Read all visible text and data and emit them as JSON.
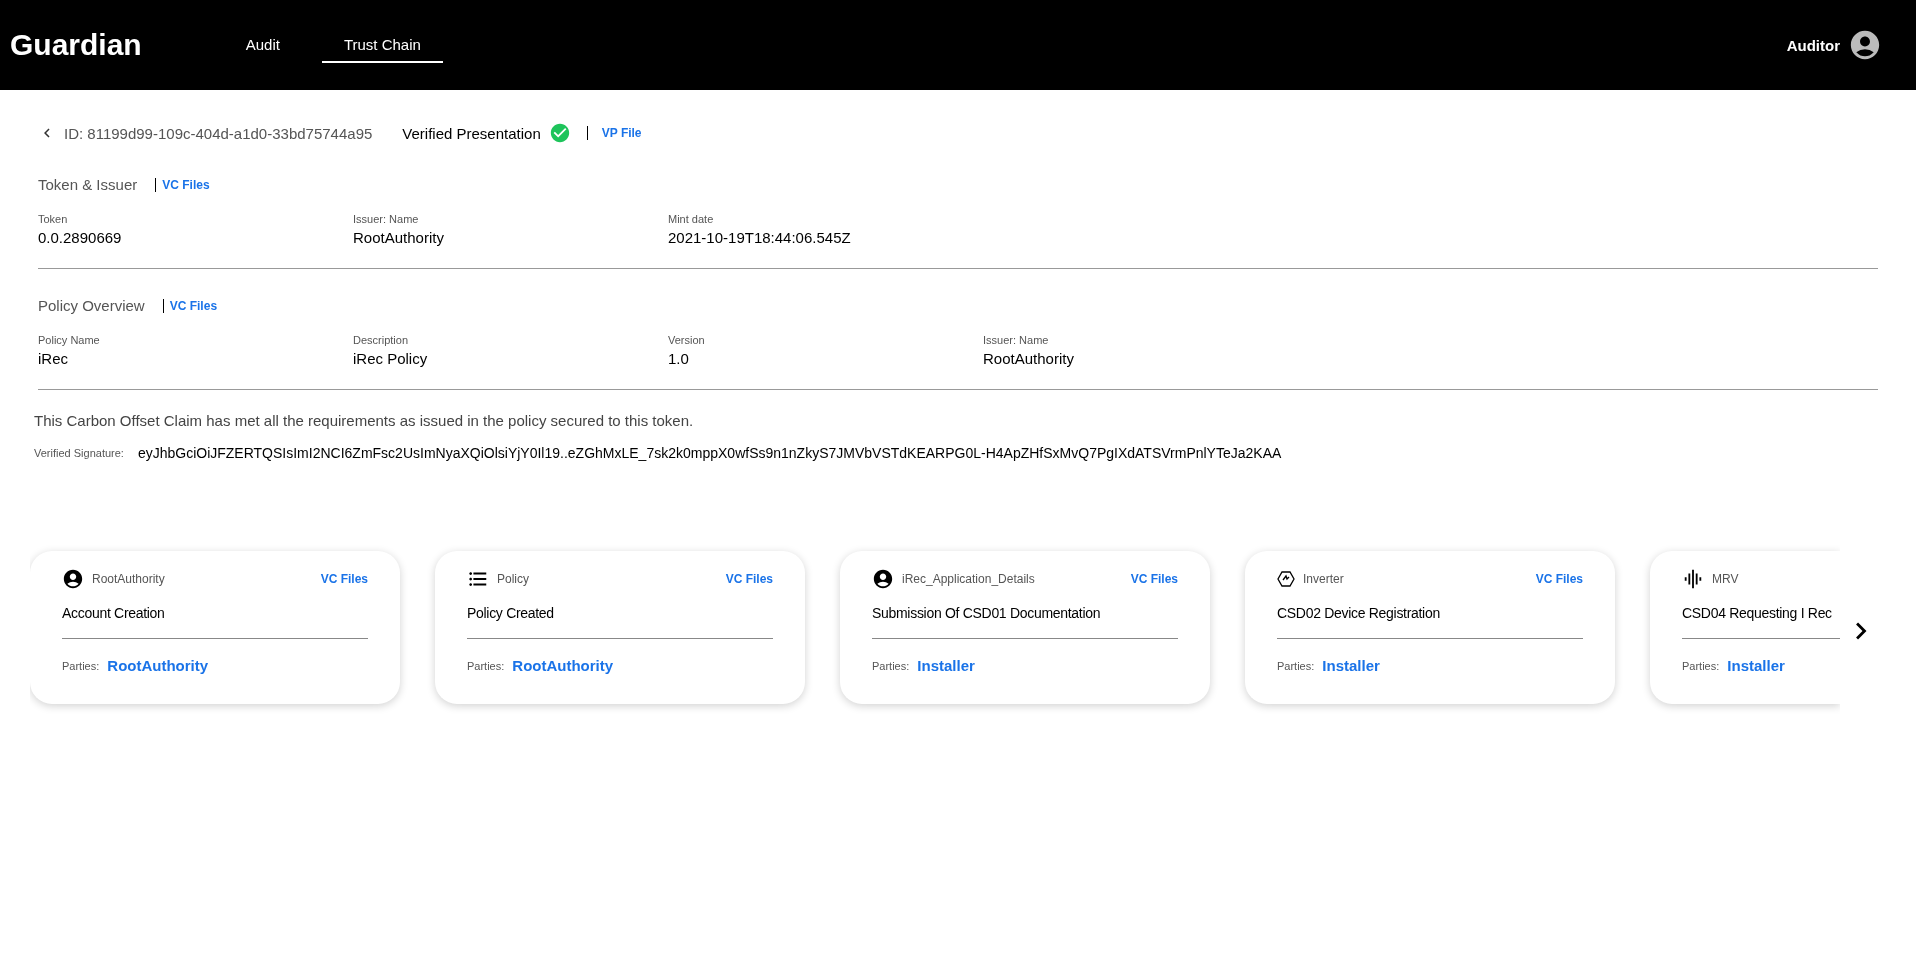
{
  "header": {
    "logo": "Guardian",
    "tabs": [
      {
        "label": "Audit",
        "selected": false
      },
      {
        "label": "Trust Chain",
        "selected": true
      }
    ],
    "user": "Auditor"
  },
  "presentation": {
    "id": "ID: 81199d99-109c-404d-a1d0-33bd75744a95",
    "title": "Verified Presentation",
    "verified": true,
    "link": "VP File"
  },
  "sections": [
    {
      "title": "Token & Issuer",
      "link": "VC Files",
      "fields": [
        {
          "label": "Token",
          "value": "0.0.2890669"
        },
        {
          "label": "Issuer: Name",
          "value": "RootAuthority"
        },
        {
          "label": "Mint date",
          "value": "2021-10-19T18:44:06.545Z"
        }
      ]
    },
    {
      "title": "Policy Overview",
      "link": "VC Files",
      "fields": [
        {
          "label": "Policy Name",
          "value": "iRec"
        },
        {
          "label": "Description",
          "value": "iRec Policy"
        },
        {
          "label": "Version",
          "value": "1.0"
        },
        {
          "label": "Issuer: Name",
          "value": "RootAuthority"
        }
      ]
    }
  ],
  "claim": "This Carbon Offset Claim has met all the requirements as issued in the policy secured to this token.",
  "signature": {
    "label": "Verified Signature:",
    "value": "eyJhbGciOiJFZERTQSIsImI2NCI6ZmFsc2UsImNyaXQiOlsiYjY0Il19..eZGhMxLE_7sk2k0mppX0wfSs9n1nZkyS7JMVbVSTdKEARPG0L-H4ApZHfSxMvQ7PgIXdATSVrmPnlYTeJa2KAA"
  },
  "cards": [
    {
      "kind": "account",
      "entity": "RootAuthority",
      "link": "VC Files",
      "title": "Account Creation",
      "parties_label": "Parties:",
      "party": "RootAuthority"
    },
    {
      "kind": "list",
      "entity": "Policy",
      "link": "VC Files",
      "title": "Policy Created",
      "parties_label": "Parties:",
      "party": "RootAuthority"
    },
    {
      "kind": "account",
      "entity": "iRec_Application_Details",
      "link": "VC Files",
      "title": "Submission Of CSD01 Documentation",
      "parties_label": "Parties:",
      "party": "Installer"
    },
    {
      "kind": "device",
      "entity": "Inverter",
      "link": "VC Files",
      "title": "CSD02 Device Registration",
      "parties_label": "Parties:",
      "party": "Installer"
    },
    {
      "kind": "wave",
      "entity": "MRV",
      "title": "CSD04 Requesting I Rec",
      "parties_label": "Parties:",
      "party": "Installer"
    }
  ]
}
